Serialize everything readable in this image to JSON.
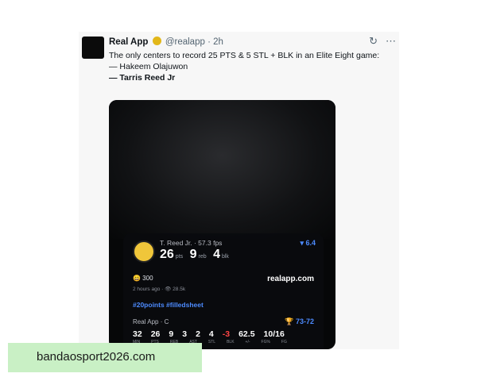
{
  "post": {
    "name": "Real App",
    "handle": "@realapp",
    "time": "· 2h",
    "lines": [
      "The only centers to record 25 PTS & 5 STL + BLK in an Elite Eight game:",
      "— Hakeem Olajuwon",
      "— Tarris Reed Jr"
    ]
  },
  "icons": [
    "verified-badge",
    "refresh-icon",
    "more-icon"
  ],
  "overlay": {
    "player": "T. Reed Jr. · 57.3 fps",
    "rank": "▾ 6.4",
    "pts": "26",
    "pts_label": "pts",
    "reb": "9",
    "reb_label": "reb",
    "blk": "4",
    "blk_label": "blk",
    "reactions": "😄 300",
    "time": "2 hours ago · 👁 28.5k",
    "site": "realapp.com",
    "tags": "#20points  #filledsheet",
    "source": "Real App · C",
    "score": "🏆 73-72",
    "row": [
      "32",
      "26",
      "9",
      "3",
      "2",
      "4",
      "-3",
      "62.5",
      "10/16"
    ],
    "labels": [
      "MIN",
      "PTS",
      "REB",
      "AST",
      "STL",
      "BLK",
      "+/-",
      "FG%",
      "FG"
    ]
  },
  "banner": "bandaosport2026.com"
}
